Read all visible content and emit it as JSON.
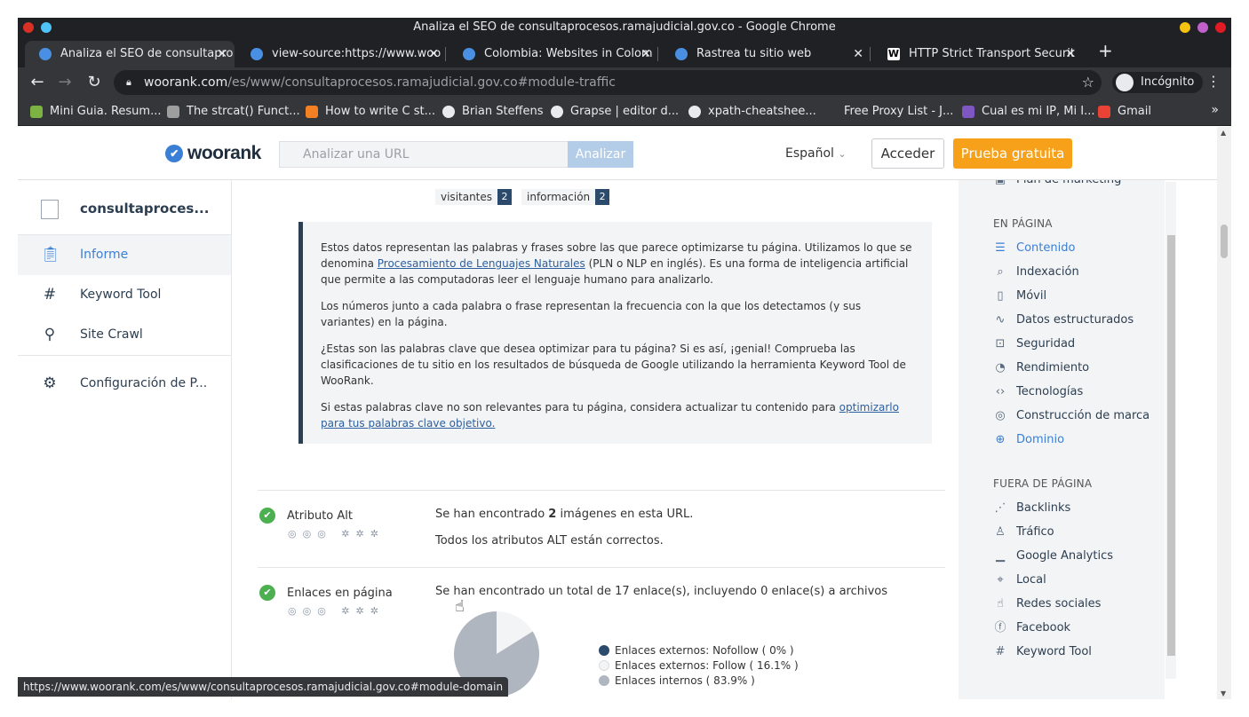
{
  "window": {
    "title": "Analiza el SEO de consultaprocesos.ramajudicial.gov.co - Google Chrome"
  },
  "tabs": [
    {
      "label": "Analiza el SEO de consultapro",
      "active": true
    },
    {
      "label": "view-source:https://www.woo",
      "active": false
    },
    {
      "label": "Colombia: Websites in Colom",
      "active": false
    },
    {
      "label": "Rastrea tu sitio web",
      "active": false
    },
    {
      "label": "HTTP Strict Transport Securit",
      "active": false
    }
  ],
  "toolbar": {
    "url_host": "woorank.com",
    "url_path": "/es/www/consultaprocesos.ramajudicial.gov.co#module-traffic",
    "incognito_label": "Incógnito"
  },
  "bookmarks": [
    {
      "label": "Mini Guia. Resum...",
      "color": "#7cb342"
    },
    {
      "label": "The strcat() Funct...",
      "color": "#9e9e9e"
    },
    {
      "label": "How to write C st...",
      "color": "#f48024"
    },
    {
      "label": "Brian Steffens",
      "color": "#e8eaed"
    },
    {
      "label": "Grapse | editor d...",
      "color": "#e8eaed"
    },
    {
      "label": "xpath-cheatshee...",
      "color": "#e8eaed"
    },
    {
      "label": "Free Proxy List - J...",
      "color": "#35363a"
    },
    {
      "label": "Cual es mi IP, Mi I...",
      "color": "#7e57c2"
    },
    {
      "label": "Gmail",
      "color": "#ea4335"
    }
  ],
  "header": {
    "logo": "woorank",
    "url_placeholder": "Analizar una URL",
    "analyze_label": "Analizar",
    "language": "Español",
    "login_label": "Acceder",
    "trial_label": "Prueba gratuita"
  },
  "leftnav": {
    "site": "consultaproces...",
    "items": [
      {
        "label": "Informe"
      },
      {
        "label": "Keyword Tool"
      },
      {
        "label": "Site Crawl"
      },
      {
        "label": "Configuración de P..."
      }
    ]
  },
  "content": {
    "tags": [
      {
        "word": "visitantes",
        "count": "2"
      },
      {
        "word": "información",
        "count": "2"
      }
    ],
    "info": {
      "p1_a": "Estos datos representan las palabras y frases sobre las que parece optimizarse tu página. Utilizamos lo que se denomina ",
      "p1_link": "Procesamiento de Lenguajes Naturales",
      "p1_b": " (PLN o NLP en inglés). Es una forma de inteligencia artificial que permite a las computadoras leer el lenguaje humano para analizarlo.",
      "p2": "Los números junto a cada palabra o frase representan la frecuencia con la que los detectamos (y sus variantes) en la página.",
      "p3": "¿Estas son las palabras clave que desea optimizar para tu página? Si es así, ¡genial! Comprueba las clasificaciones de tu sitio en los resultados de búsqueda de Google utilizando la herramienta Keyword Tool de WooRank.",
      "p4_a": "Si estas palabras clave no son relevantes para tu página, considera actualizar tu contenido para ",
      "p4_link": "optimizarlo para tus palabras clave objetivo."
    },
    "alt": {
      "title": "Atributo Alt",
      "line1_a": "Se han encontrado ",
      "line1_b": "2",
      "line1_c": " imágenes en esta URL.",
      "line2": "Todos los atributos ALT están correctos."
    },
    "links": {
      "title": "Enlaces en página",
      "line1": "Se han encontrado un total de 17 enlace(s), incluyendo 0 enlace(s) a archivos"
    }
  },
  "chart_data": {
    "type": "pie",
    "categories": [
      "Enlaces externos: Nofollow ( 0% )",
      "Enlaces externos: Follow ( 16.1% )",
      "Enlaces internos ( 83.9% )"
    ],
    "values": [
      0,
      16.1,
      83.9
    ],
    "colors": [
      "#2c4a6b",
      "#f3f4f6",
      "#b0b6c0"
    ]
  },
  "rightnav": {
    "top_partial": "Plan de marketing",
    "section1": "EN PÁGINA",
    "items1": [
      {
        "label": "Contenido",
        "icon": "☰"
      },
      {
        "label": "Indexación",
        "icon": "⌕"
      },
      {
        "label": "Móvil",
        "icon": "▯"
      },
      {
        "label": "Datos estructurados",
        "icon": "∿"
      },
      {
        "label": "Seguridad",
        "icon": "⊡"
      },
      {
        "label": "Rendimiento",
        "icon": "◔"
      },
      {
        "label": "Tecnologías",
        "icon": "‹›"
      },
      {
        "label": "Construcción de marca",
        "icon": "◎"
      },
      {
        "label": "Dominio",
        "icon": "⊕"
      }
    ],
    "section2": "FUERA DE PÁGINA",
    "items2": [
      {
        "label": "Backlinks",
        "icon": "⋰"
      },
      {
        "label": "Tráfico",
        "icon": "♙"
      },
      {
        "label": "Google Analytics",
        "icon": "▁"
      },
      {
        "label": "Local",
        "icon": "⌖"
      },
      {
        "label": "Redes sociales",
        "icon": "☝"
      },
      {
        "label": "Facebook",
        "icon": "ⓕ"
      },
      {
        "label": "Keyword Tool",
        "icon": "#"
      }
    ]
  },
  "statusbar": "https://www.woorank.com/es/www/consultaprocesos.ramajudicial.gov.co#module-domain"
}
